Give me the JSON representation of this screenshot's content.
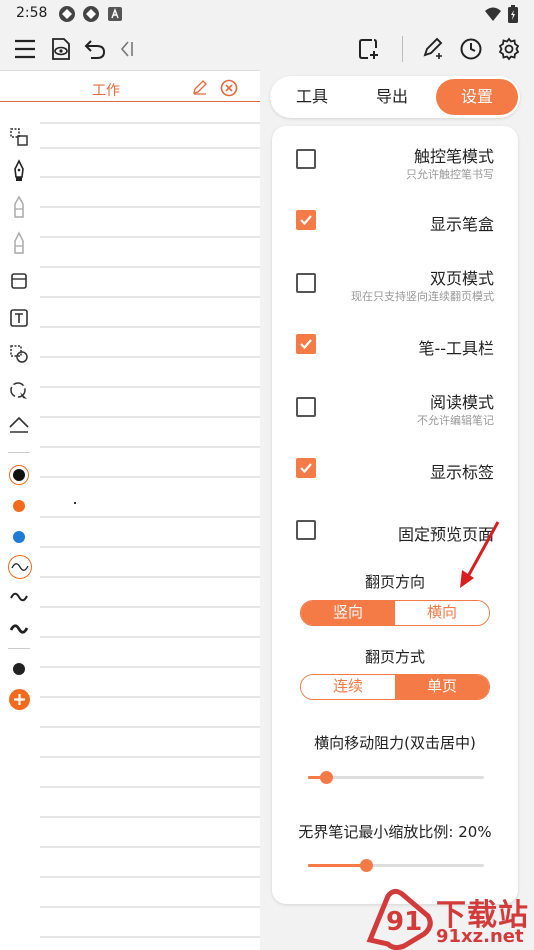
{
  "status": {
    "time": "2:58"
  },
  "note": {
    "title": "工作"
  },
  "tabs": [
    {
      "label": "工具"
    },
    {
      "label": "导出"
    },
    {
      "label": "设置"
    }
  ],
  "settings": {
    "toggles": [
      {
        "label": "触控笔模式",
        "sub": "只允许触控笔书写",
        "checked": false
      },
      {
        "label": "显示笔盒",
        "sub": "",
        "checked": true
      },
      {
        "label": "双页模式",
        "sub": "现在只支持竖向连续翻页模式",
        "checked": false
      },
      {
        "label": "笔--工具栏",
        "sub": "",
        "checked": true
      },
      {
        "label": "阅读模式",
        "sub": "不允许编辑笔记",
        "checked": false
      },
      {
        "label": "显示标签",
        "sub": "",
        "checked": true
      },
      {
        "label": "固定预览页面",
        "sub": "",
        "checked": false
      }
    ],
    "page_direction": {
      "label": "翻页方向",
      "options": [
        "竖向",
        "横向"
      ],
      "selected": 0
    },
    "page_mode": {
      "label": "翻页方式",
      "options": [
        "连续",
        "单页"
      ],
      "selected": 1
    },
    "drag_resistance": {
      "label": "横向移动阻力(双击居中)",
      "value": 0.1
    },
    "min_zoom": {
      "label": "无界笔记最小缩放比例: 20%",
      "value": 0.33
    }
  },
  "watermark": {
    "text": "下载站",
    "url": "91xz.net"
  },
  "colors": {
    "accent": "#f47a46",
    "pen_orange": "#f26b1d",
    "pen_blue": "#1e7bd6",
    "pen_black": "#111111"
  }
}
